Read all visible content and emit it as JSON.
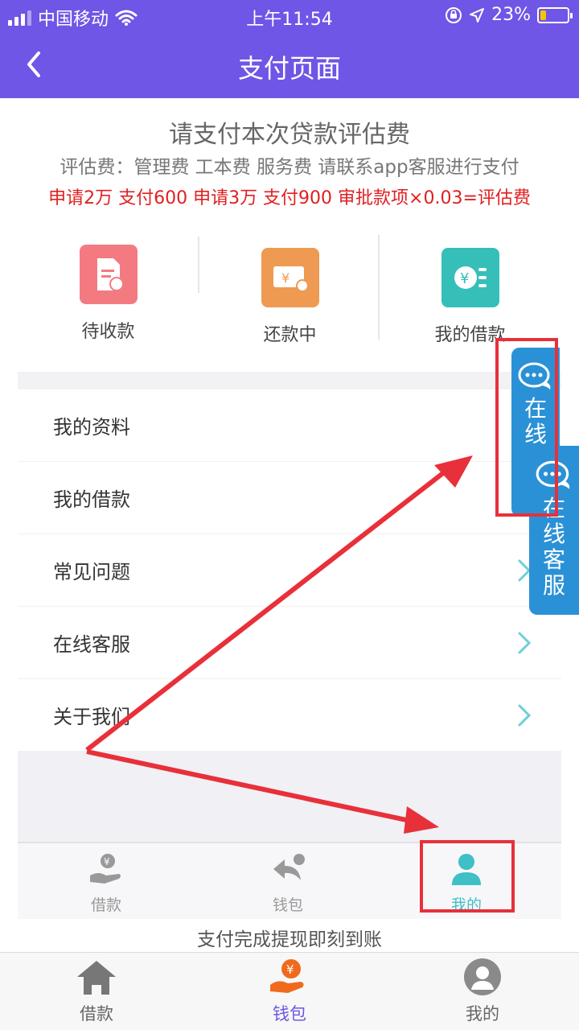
{
  "status_bar": {
    "carrier": "中国移动",
    "time": "上午11:54",
    "battery": "23%",
    "battery_level": 0.23
  },
  "nav": {
    "title": "支付页面"
  },
  "header": {
    "title": "请支付本次贷款评估费",
    "subtitle": "评估费：管理费 工本费 服务费 请联系app客服进行支付",
    "rates": "申请2万 支付600  申请3万 支付900 审批款项×0.03=评估费"
  },
  "embedded": {
    "quick_items": [
      {
        "label": "待收款",
        "icon": "receipt-icon",
        "color": "#f47a82"
      },
      {
        "label": "还款中",
        "icon": "bill-icon",
        "color": "#ee9a52"
      },
      {
        "label": "我的借款",
        "icon": "yuan-coins-icon",
        "color": "#35bfb8"
      }
    ],
    "menu": [
      {
        "label": "我的资料"
      },
      {
        "label": "我的借款"
      },
      {
        "label": "常见问题"
      },
      {
        "label": "在线客服"
      },
      {
        "label": "关于我们"
      }
    ],
    "tabs": [
      {
        "label": "借款",
        "active": false
      },
      {
        "label": "钱包",
        "active": false
      },
      {
        "label": "我的",
        "active": true
      }
    ]
  },
  "float_service": {
    "back_label": "在线",
    "label": "在线客服"
  },
  "footer_note": "支付完成提现即刻到账",
  "tabbar": {
    "items": [
      {
        "label": "借款",
        "icon": "home-icon",
        "active": false
      },
      {
        "label": "钱包",
        "icon": "wallet-yuan-icon",
        "active": true
      },
      {
        "label": "我的",
        "icon": "user-icon",
        "active": false
      }
    ]
  },
  "colors": {
    "primary": "#6f56e6",
    "alert_red": "#e02020",
    "service_blue": "#2b91d6",
    "annotation_red": "#e8303a",
    "teal": "#3fbfc6"
  }
}
